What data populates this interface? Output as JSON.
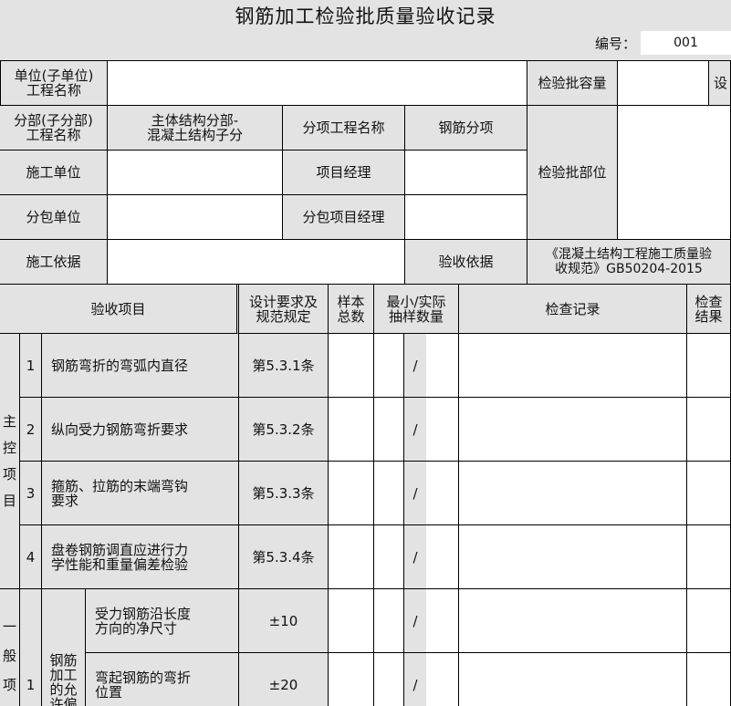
{
  "title": "钢筋加工检验批质量验收记录",
  "number_label": "编号：",
  "number_value": "001",
  "header": {
    "unit_label": "单位(子单位)\n工程名称",
    "unit_value": "",
    "capacity_label": "检验批容量",
    "capacity_value": "",
    "capacity_extra": "设",
    "division_label": "分部(子分部)\n工程名称",
    "division_value": "主体结构分部-\n混凝土结构子分",
    "subitem_label": "分项工程名称",
    "subitem_value": "钢筋分项",
    "location_label": "检验批部位",
    "constructor_label": "施工单位",
    "pm_label": "项目经理",
    "subcontractor_label": "分包单位",
    "sub_pm_label": "分包项目经理",
    "basis_label": "施工依据",
    "acceptance_label": "验收依据",
    "acceptance_value": "《混凝土结构工程施工质量验\n收规范》GB50204-2015"
  },
  "columns": {
    "item": "验收项目",
    "design": "设计要求及\n规范规定",
    "sample_total": "样本\n总数",
    "sampling": "最小/实际\n抽样数量",
    "record": "检查记录",
    "result": "检查\n结果"
  },
  "main_control": {
    "label": "主\n控\n项\n目",
    "rows": [
      {
        "no": "1",
        "item": "钢筋弯折的弯弧内直径",
        "spec": "第5.3.1条",
        "sampling": "/"
      },
      {
        "no": "2",
        "item": "纵向受力钢筋弯折要求",
        "spec": "第5.3.2条",
        "sampling": "/"
      },
      {
        "no": "3",
        "item": "箍筋、拉筋的末端弯钩\n要求",
        "spec": "第5.3.3条",
        "sampling": "/"
      },
      {
        "no": "4",
        "item": "盘卷钢筋调直应进行力\n学性能和重量偏差检验",
        "spec": "第5.3.4条",
        "sampling": "/"
      }
    ]
  },
  "general": {
    "label": "一\n般\n项",
    "no": "1",
    "group": "钢筋\n加工\n的允\n许偏",
    "rows": [
      {
        "item": "受力钢筋沿长度\n方向的净尺寸",
        "spec": "±10",
        "sampling": "/"
      },
      {
        "item": "弯起钢筋的弯折\n位置",
        "spec": "±20",
        "sampling": "/"
      }
    ]
  }
}
